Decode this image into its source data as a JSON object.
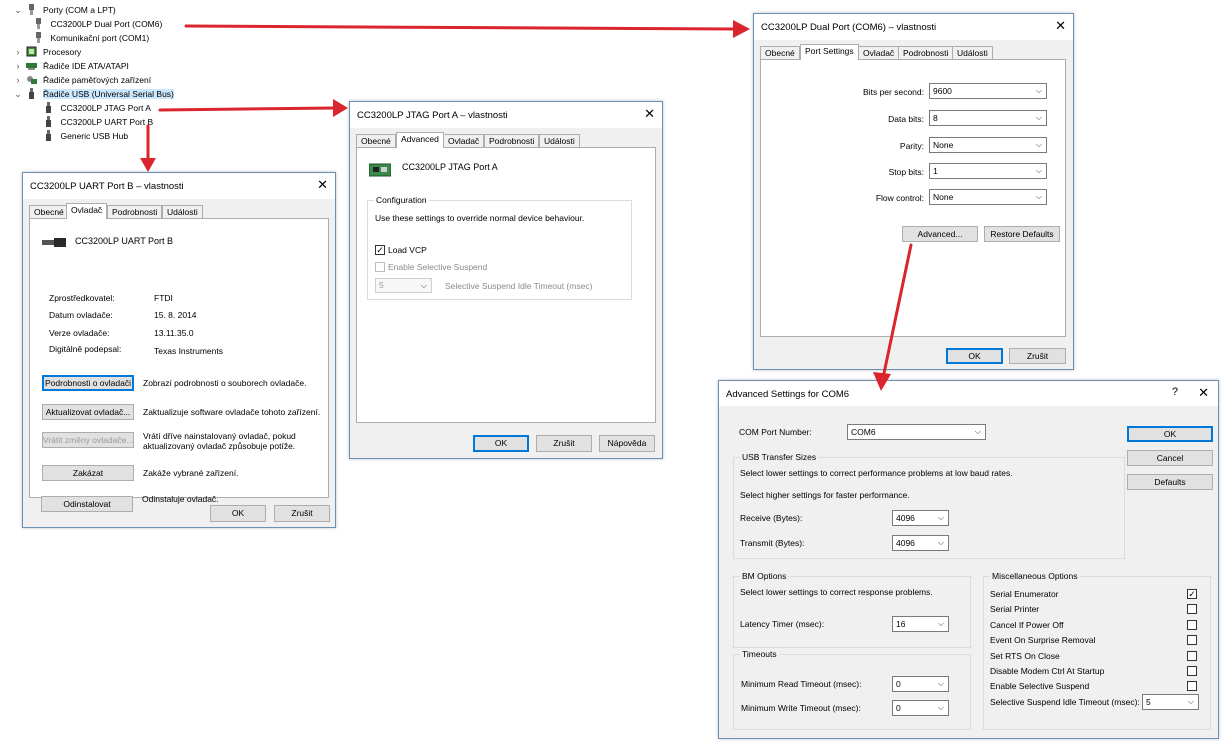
{
  "device_tree": {
    "items": [
      {
        "label": "Porty (COM a LPT)",
        "expander": "⌄",
        "icon": "port-icon",
        "level": 0
      },
      {
        "label": "CC3200LP Dual Port (COM6)",
        "expander": "",
        "icon": "port-icon",
        "level": 1
      },
      {
        "label": "Komunikační port (COM1)",
        "expander": "",
        "icon": "port-icon",
        "level": 1
      },
      {
        "label": "Procesory",
        "expander": "›",
        "icon": "processor-icon",
        "level": 0
      },
      {
        "label": "Řadiče IDE ATA/ATAPI",
        "expander": "›",
        "icon": "ide-icon",
        "level": 0
      },
      {
        "label": "Řadiče paměťových zařízení",
        "expander": "›",
        "icon": "storage-icon",
        "level": 0
      },
      {
        "label": "Řadiče USB (Universal Serial Bus)",
        "expander": "⌄",
        "icon": "usb-icon",
        "level": 0,
        "selected": true
      },
      {
        "label": "CC3200LP JTAG Port A",
        "expander": "",
        "icon": "usb-icon",
        "level": 1
      },
      {
        "label": "CC3200LP UART Port B",
        "expander": "",
        "icon": "usb-icon",
        "level": 1
      },
      {
        "label": "Generic USB Hub",
        "expander": "",
        "icon": "usb-icon",
        "level": 1
      }
    ]
  },
  "uart_dialog": {
    "title": "CC3200LP UART Port B – vlastnosti",
    "tabs": [
      "Obecné",
      "Ovladač",
      "Podrobnosti",
      "Události"
    ],
    "device_name": "CC3200LP UART Port B",
    "info": [
      {
        "label": "Zprostředkovatel:",
        "value": "FTDI"
      },
      {
        "label": "Datum ovladače:",
        "value": "15. 8. 2014"
      },
      {
        "label": "Verze ovladače:",
        "value": "13.11.35.0"
      },
      {
        "label": "Digitálně podepsal:",
        "value": "Texas Instruments"
      }
    ],
    "actions": [
      {
        "button": "Podrobnosti o ovladači",
        "desc": "Zobrazí podrobnosti o souborech ovladače."
      },
      {
        "button": "Aktualizovat ovladač...",
        "desc": "Zaktualizuje software ovladače tohoto zařízení."
      },
      {
        "button": "Vrátit změny ovladače...",
        "desc": "Vrátí dříve nainstalovaný ovladač, pokud aktualizovaný ovladač způsobuje potíže."
      },
      {
        "button": "Zakázat",
        "desc": "Zakáže vybrané zařízení."
      },
      {
        "button": "Odinstalovat",
        "desc": "Odinstaluje ovladač."
      }
    ],
    "ok": "OK",
    "cancel": "Zrušit"
  },
  "jtag_dialog": {
    "title": "CC3200LP JTAG Port A – vlastnosti",
    "tabs": [
      "Obecné",
      "Advanced",
      "Ovladač",
      "Podrobnosti",
      "Události"
    ],
    "device_name": "CC3200LP JTAG Port A",
    "config_title": "Configuration",
    "config_text": "Use these settings to override normal device behaviour.",
    "load_vcp": "Load VCP",
    "load_vcp_checked": true,
    "selective_suspend": "Enable Selective Suspend",
    "suspend_value": "5",
    "suspend_timeout_label": "Selective Suspend Idle Timeout (msec)",
    "ok": "OK",
    "cancel": "Zrušit",
    "help": "Nápověda"
  },
  "dual_dialog": {
    "title": "CC3200LP Dual Port (COM6) – vlastnosti",
    "tabs": [
      "Obecné",
      "Port Settings",
      "Ovladač",
      "Podrobnosti",
      "Události"
    ],
    "fields": [
      {
        "label": "Bits per second:",
        "value": "9600"
      },
      {
        "label": "Data bits:",
        "value": "8"
      },
      {
        "label": "Parity:",
        "value": "None"
      },
      {
        "label": "Stop bits:",
        "value": "1"
      },
      {
        "label": "Flow control:",
        "value": "None"
      }
    ],
    "advanced": "Advanced...",
    "restore": "Restore Defaults",
    "ok": "OK",
    "cancel": "Zrušit"
  },
  "adv_dialog": {
    "title": "Advanced Settings for COM6",
    "help_glyph": "?",
    "com_label": "COM Port Number:",
    "com_value": "COM6",
    "usb_title": "USB Transfer Sizes",
    "usb_text1": "Select lower settings to correct performance problems at low baud rates.",
    "usb_text2": "Select higher settings for faster performance.",
    "receive_label": "Receive (Bytes):",
    "receive_value": "4096",
    "transmit_label": "Transmit (Bytes):",
    "transmit_value": "4096",
    "bm_title": "BM Options",
    "bm_text": "Select lower settings to correct response problems.",
    "latency_label": "Latency Timer (msec):",
    "latency_value": "16",
    "timeouts_title": "Timeouts",
    "min_read_label": "Minimum Read Timeout (msec):",
    "min_read_value": "0",
    "min_write_label": "Minimum Write Timeout (msec):",
    "min_write_value": "0",
    "misc_title": "Miscellaneous Options",
    "misc": [
      {
        "label": "Serial Enumerator",
        "checked": true
      },
      {
        "label": "Serial Printer",
        "checked": false
      },
      {
        "label": "Cancel If Power Off",
        "checked": false
      },
      {
        "label": "Event On Surprise Removal",
        "checked": false
      },
      {
        "label": "Set RTS On Close",
        "checked": false
      },
      {
        "label": "Disable Modem Ctrl At Startup",
        "checked": false
      },
      {
        "label": "Enable Selective Suspend",
        "checked": false
      }
    ],
    "suspend_label": "Selective Suspend Idle Timeout (msec):",
    "suspend_value": "5",
    "ok": "OK",
    "cancel": "Cancel",
    "defaults": "Defaults"
  },
  "colors": {
    "arrow": "#d9252b",
    "selection": "#cce8ff",
    "dialog_border": "#6b8fb5",
    "focus": "#0078d7"
  }
}
